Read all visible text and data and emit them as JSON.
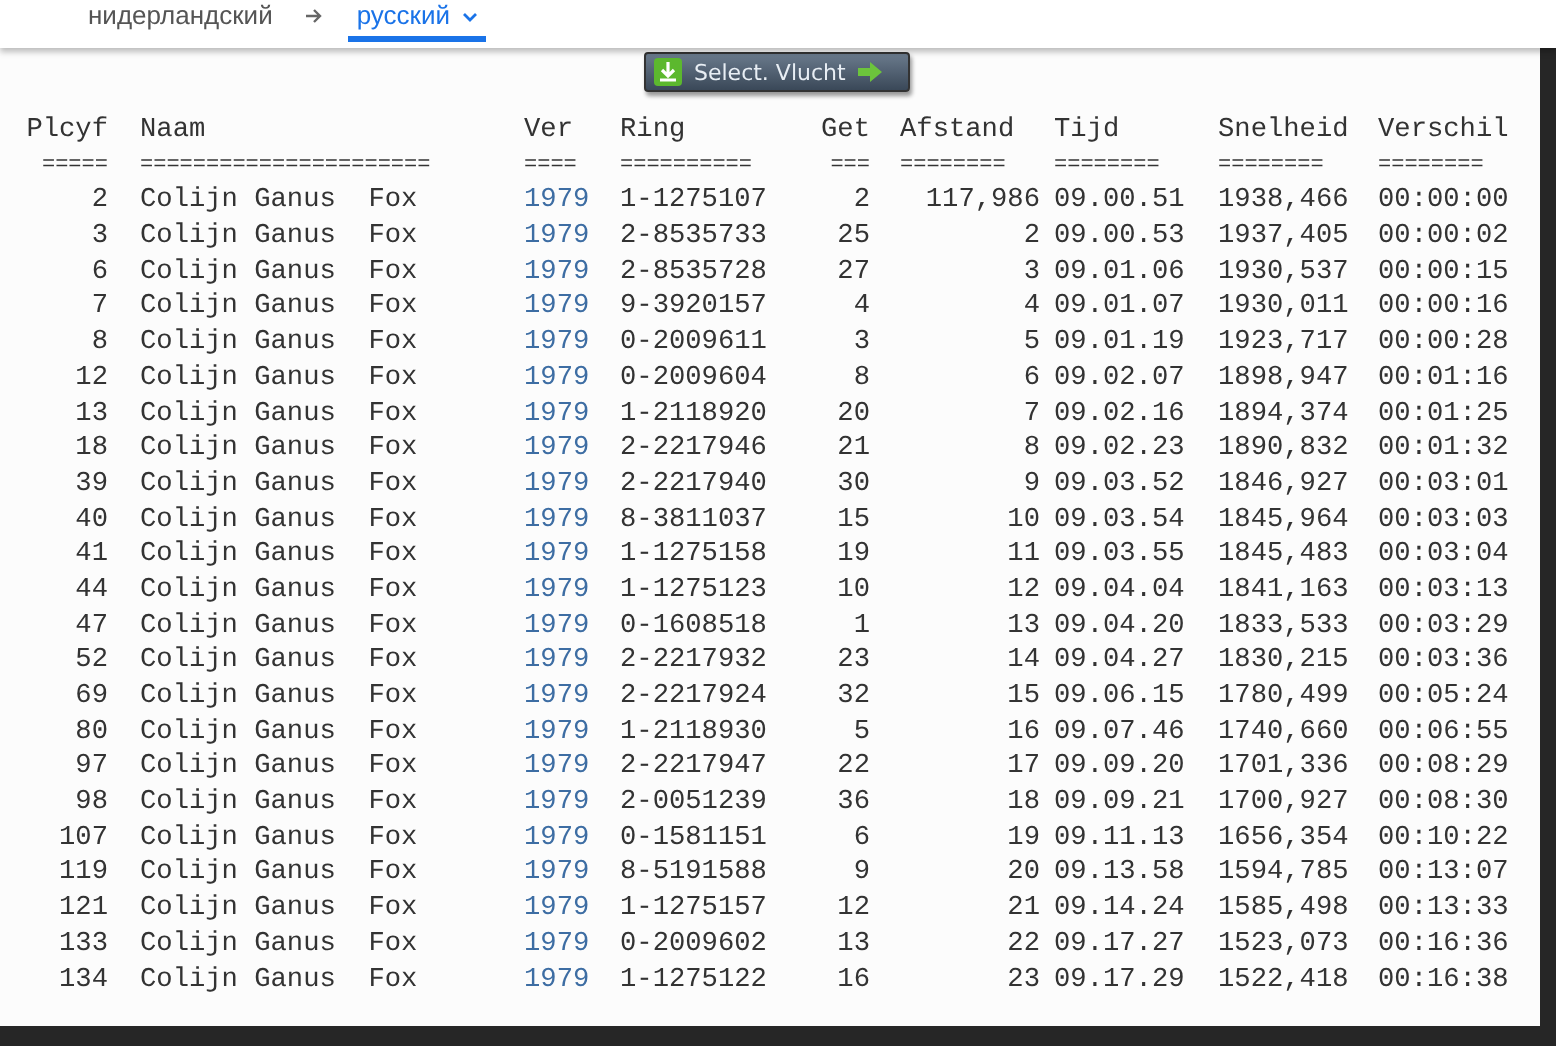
{
  "language_tabs": [
    {
      "label": "нидерландский",
      "selected": false
    },
    {
      "label": "русский",
      "selected": true
    }
  ],
  "select_button": {
    "label": "Select. Vlucht"
  },
  "table": {
    "columns": [
      {
        "label": "Plcyf",
        "underline": "====="
      },
      {
        "label": "Naam",
        "underline": "======================"
      },
      {
        "label": "Ver",
        "underline": "===="
      },
      {
        "label": "Ring",
        "underline": "=========="
      },
      {
        "label": "Get",
        "underline": "==="
      },
      {
        "label": "Afstand",
        "underline": "========"
      },
      {
        "label": "Tijd",
        "underline": "========"
      },
      {
        "label": "Snelheid",
        "underline": "========"
      },
      {
        "label": "Verschil",
        "underline": "========"
      }
    ],
    "rows": [
      [
        "2",
        "Colijn Ganus  Fox",
        "1979",
        "1-1275107",
        "2",
        "117,986",
        "09.00.51",
        "1938,466",
        "00:00:00"
      ],
      [
        "3",
        "Colijn Ganus  Fox",
        "1979",
        "2-8535733",
        "25",
        "2",
        "09.00.53",
        "1937,405",
        "00:00:02"
      ],
      [
        "6",
        "Colijn Ganus  Fox",
        "1979",
        "2-8535728",
        "27",
        "3",
        "09.01.06",
        "1930,537",
        "00:00:15"
      ],
      [
        "7",
        "Colijn Ganus  Fox",
        "1979",
        "9-3920157",
        "4",
        "4",
        "09.01.07",
        "1930,011",
        "00:00:16"
      ],
      [
        "8",
        "Colijn Ganus  Fox",
        "1979",
        "0-2009611",
        "3",
        "5",
        "09.01.19",
        "1923,717",
        "00:00:28"
      ],
      [
        "12",
        "Colijn Ganus  Fox",
        "1979",
        "0-2009604",
        "8",
        "6",
        "09.02.07",
        "1898,947",
        "00:01:16"
      ],
      [
        "13",
        "Colijn Ganus  Fox",
        "1979",
        "1-2118920",
        "20",
        "7",
        "09.02.16",
        "1894,374",
        "00:01:25"
      ],
      [
        "18",
        "Colijn Ganus  Fox",
        "1979",
        "2-2217946",
        "21",
        "8",
        "09.02.23",
        "1890,832",
        "00:01:32"
      ],
      [
        "39",
        "Colijn Ganus  Fox",
        "1979",
        "2-2217940",
        "30",
        "9",
        "09.03.52",
        "1846,927",
        "00:03:01"
      ],
      [
        "40",
        "Colijn Ganus  Fox",
        "1979",
        "8-3811037",
        "15",
        "10",
        "09.03.54",
        "1845,964",
        "00:03:03"
      ],
      [
        "41",
        "Colijn Ganus  Fox",
        "1979",
        "1-1275158",
        "19",
        "11",
        "09.03.55",
        "1845,483",
        "00:03:04"
      ],
      [
        "44",
        "Colijn Ganus  Fox",
        "1979",
        "1-1275123",
        "10",
        "12",
        "09.04.04",
        "1841,163",
        "00:03:13"
      ],
      [
        "47",
        "Colijn Ganus  Fox",
        "1979",
        "0-1608518",
        "1",
        "13",
        "09.04.20",
        "1833,533",
        "00:03:29"
      ],
      [
        "52",
        "Colijn Ganus  Fox",
        "1979",
        "2-2217932",
        "23",
        "14",
        "09.04.27",
        "1830,215",
        "00:03:36"
      ],
      [
        "69",
        "Colijn Ganus  Fox",
        "1979",
        "2-2217924",
        "32",
        "15",
        "09.06.15",
        "1780,499",
        "00:05:24"
      ],
      [
        "80",
        "Colijn Ganus  Fox",
        "1979",
        "1-2118930",
        "5",
        "16",
        "09.07.46",
        "1740,660",
        "00:06:55"
      ],
      [
        "97",
        "Colijn Ganus  Fox",
        "1979",
        "2-2217947",
        "22",
        "17",
        "09.09.20",
        "1701,336",
        "00:08:29"
      ],
      [
        "98",
        "Colijn Ganus  Fox",
        "1979",
        "2-0051239",
        "36",
        "18",
        "09.09.21",
        "1700,927",
        "00:08:30"
      ],
      [
        "107",
        "Colijn Ganus  Fox",
        "1979",
        "0-1581151",
        "6",
        "19",
        "09.11.13",
        "1656,354",
        "00:10:22"
      ],
      [
        "119",
        "Colijn Ganus  Fox",
        "1979",
        "8-5191588",
        "9",
        "20",
        "09.13.58",
        "1594,785",
        "00:13:07"
      ],
      [
        "121",
        "Colijn Ganus  Fox",
        "1979",
        "1-1275157",
        "12",
        "21",
        "09.14.24",
        "1585,498",
        "00:13:33"
      ],
      [
        "133",
        "Colijn Ganus  Fox",
        "1979",
        "0-2009602",
        "13",
        "22",
        "09.17.27",
        "1523,073",
        "00:16:36"
      ],
      [
        "134",
        "Colijn Ganus  Fox",
        "1979",
        "1-1275122",
        "16",
        "23",
        "09.17.29",
        "1522,418",
        "00:16:38"
      ]
    ]
  }
}
